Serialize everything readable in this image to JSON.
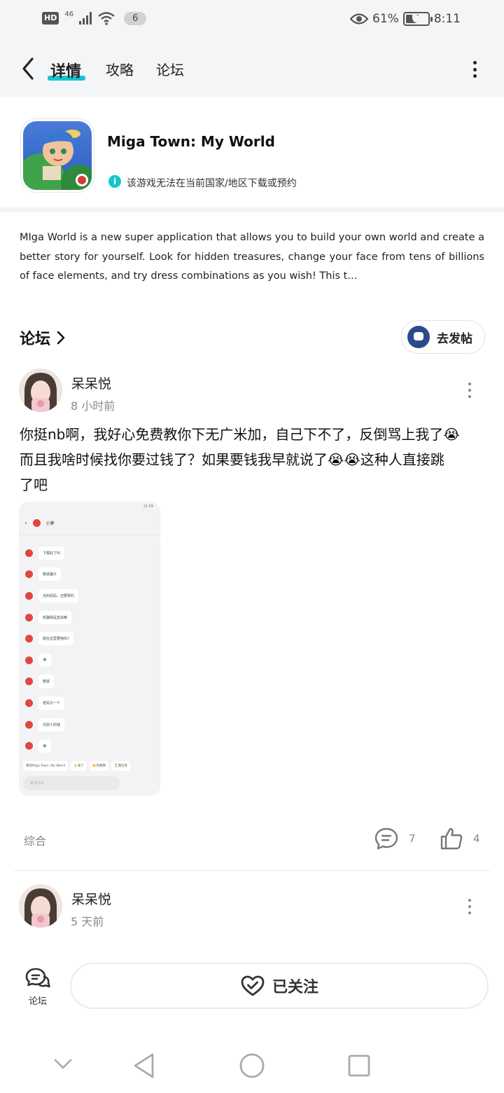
{
  "status_bar": {
    "hd": "HD",
    "network": "46",
    "notification_count": "6",
    "battery_percent": "61%",
    "battery_level": 0.61,
    "time": "8:11"
  },
  "header": {
    "tabs": [
      {
        "label": "详情",
        "active": true
      },
      {
        "label": "攻略",
        "active": false
      },
      {
        "label": "论坛",
        "active": false
      }
    ],
    "accent_color": "#15c5ce"
  },
  "app": {
    "name": "Miga Town: My World",
    "availability_note": "该游戏无法在当前国家/地区下载或预约",
    "description": "MIga World is a new super application that allows you to build your own world and create a better story for yourself. Look for hidden treasures, change your face from tens of billions of face elements, and try dress combinations as you wish! This t..."
  },
  "forum": {
    "title": "论坛",
    "post_button": "去发帖"
  },
  "posts": [
    {
      "author": "呆呆悦",
      "time": "8 小时前",
      "text_lines": [
        "你挺nb啊，我好心免费教你下无广米加，自己下不了，反倒骂上我了😭",
        "而且我啥时候找你要过钱了？如果要钱我早就说了😭😭这种人直接跳",
        "了吧"
      ],
      "screenshot": {
        "status_time": "11:59",
        "contact": "小夢",
        "messages": [
          "下载好了叫",
          "傻逼骗子",
          "也的妈妈，还要预约",
          "想骗我是直说嘛",
          "搞在这里要啥吗?",
          "😭",
          "傻逼",
          "老妈子一个",
          "坑别人的钱",
          "😭"
        ],
        "chips": [
          "来玩Miga Town: My World",
          "👌来了",
          "👏你猜猜",
          "⏳我在等"
        ],
        "input_placeholder": "说点什么"
      },
      "tag": "综合",
      "comments": "7",
      "likes": "4"
    },
    {
      "author": "呆呆悦",
      "time": "5 天前"
    }
  ],
  "bottom_bar": {
    "forum_label": "论坛",
    "follow_label": "已关注"
  }
}
